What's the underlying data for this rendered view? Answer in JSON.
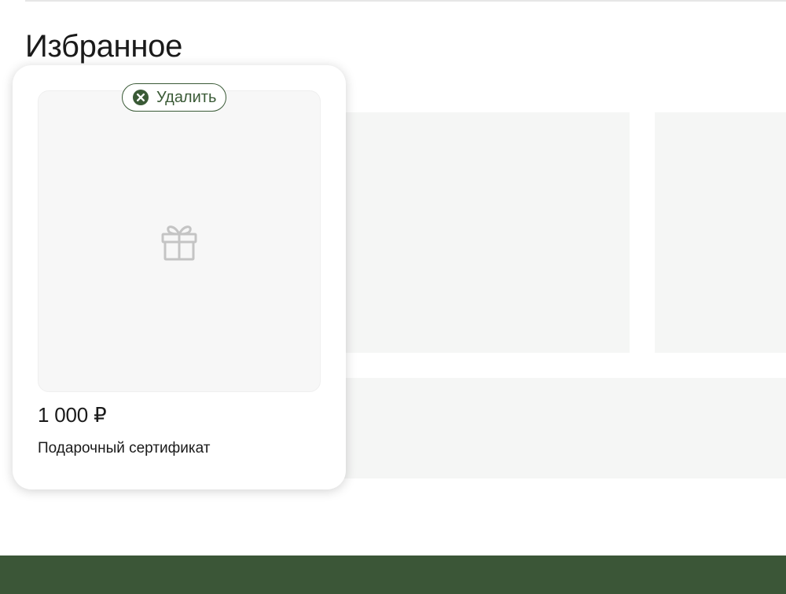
{
  "favorites": {
    "title": "Избранное",
    "items": [
      {
        "remove_label": "Удалить",
        "price": "1 000 ₽",
        "name": "Подарочный сертификат",
        "image_icon": "gift-icon"
      }
    ]
  },
  "colors": {
    "accent_green": "#3a5a36",
    "footer_green": "#3b5637",
    "placeholder_gray": "#f5f6f5"
  },
  "icons": {
    "remove": "close-circle-icon",
    "product_image": "gift-icon"
  }
}
